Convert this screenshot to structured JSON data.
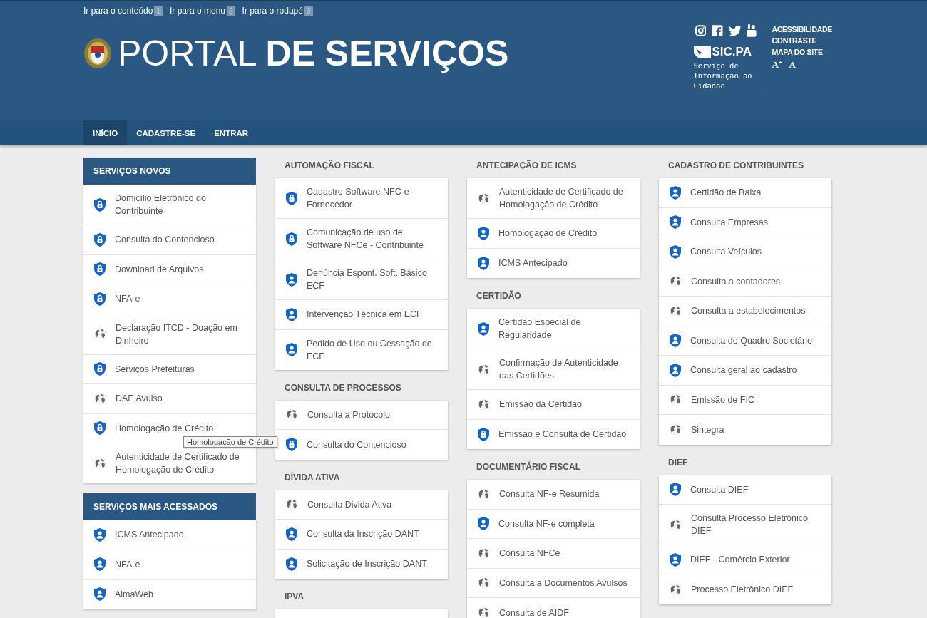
{
  "skip_links": [
    {
      "label": "Ir para o conteúdo",
      "key": "1"
    },
    {
      "label": "Ir para o menu",
      "key": "2"
    },
    {
      "label": "Ir para o rodapé",
      "key": "3"
    }
  ],
  "title": "PORTAL **DE SERVIÇOS**",
  "sic": {
    "logo_text": "SIC.PA",
    "caption": "Serviço de Informação ao Cidadão"
  },
  "accessibility": {
    "links": [
      "ACESSIBILIDADE",
      "CONTRASTE",
      "MAPA DO SITE"
    ],
    "font_up": "A",
    "font_up_mark": "+",
    "font_down": "A",
    "font_down_mark": "-"
  },
  "nav": [
    {
      "label": "INÍCIO",
      "selected": true
    },
    {
      "label": "CADASTRE-SE",
      "selected": false
    },
    {
      "label": "ENTRAR",
      "selected": false
    }
  ],
  "columns": [
    [
      {
        "kind": "panel",
        "title": "SERVIÇOS NOVOS",
        "items": [
          {
            "label": "Domicílio Eletrônico do Contribuinte",
            "kind": "lock"
          },
          {
            "label": "Consulta do Contencioso",
            "kind": "lock"
          },
          {
            "label": "Download de Arquivos",
            "kind": "lock"
          },
          {
            "label": "NFA-e",
            "kind": "lock"
          },
          {
            "label": "Declaração ITCD - Doação em Dinheiro",
            "kind": "globe"
          },
          {
            "label": "Serviços Prefeituras",
            "kind": "lock"
          },
          {
            "label": "DAE Avulso",
            "kind": "globe"
          },
          {
            "label": "Homologação de Crédito",
            "kind": "lock"
          },
          {
            "label": "Autenticidade de Certificado de Homologação de Crédito",
            "kind": "globe"
          }
        ]
      },
      {
        "kind": "panel",
        "title": "SERVIÇOS MAIS ACESSADOS",
        "items": [
          {
            "label": "ICMS Antecipado",
            "kind": "user"
          },
          {
            "label": "NFA-e",
            "kind": "user"
          },
          {
            "label": "AlmaWeb",
            "kind": "user"
          }
        ]
      }
    ],
    [
      {
        "kind": "group",
        "title": "AUTOMAÇÃO FISCAL",
        "items": [
          {
            "label": "Cadastro Software NFC-e - Fornecedor",
            "kind": "lock"
          },
          {
            "label": "Comunicação de uso de Software NFCe - Contribuinte",
            "kind": "lock"
          },
          {
            "label": "Denúncia Espont. Soft. Básico ECF",
            "kind": "user"
          },
          {
            "label": "Intervenção Técnica em ECF",
            "kind": "user"
          },
          {
            "label": "Pedido de Uso ou Cessação de ECF",
            "kind": "user"
          }
        ]
      },
      {
        "kind": "group",
        "title": "CONSULTA DE PROCESSOS",
        "items": [
          {
            "label": "Consulta a Protocolo",
            "kind": "globe"
          },
          {
            "label": "Consulta do Contencioso",
            "kind": "lock"
          }
        ]
      },
      {
        "kind": "group",
        "title": "DÍVIDA ATIVA",
        "items": [
          {
            "label": "Consulta Divida Ativa",
            "kind": "globe"
          },
          {
            "label": "Consulta da Inscrição DANT",
            "kind": "user"
          },
          {
            "label": "Solicitação de Inscrição DANT",
            "kind": "user"
          }
        ]
      },
      {
        "kind": "group",
        "title": "IPVA"
      }
    ],
    [
      {
        "kind": "group",
        "title": "ANTECIPAÇÃO DE ICMS",
        "items": [
          {
            "label": "Autenticidade de Certificado de Homologação de Crédito",
            "kind": "globe"
          },
          {
            "label": "Homologação de Crédito",
            "kind": "user"
          },
          {
            "label": "ICMS Antecipado",
            "kind": "user"
          }
        ]
      },
      {
        "kind": "group",
        "title": "CERTIDÃO",
        "items": [
          {
            "label": "Certidão Especial de Regularidade",
            "kind": "user"
          },
          {
            "label": "Confirmação de Autenticidade das Certidões",
            "kind": "globe"
          },
          {
            "label": "Emissão da Certidão",
            "kind": "globe"
          },
          {
            "label": "Emissão e Consulta de Certidão",
            "kind": "lock"
          }
        ]
      },
      {
        "kind": "group",
        "title": "DOCUMENTÁRIO FISCAL",
        "items": [
          {
            "label": "Consulta NF-e Resumida",
            "kind": "globe"
          },
          {
            "label": "Consulta NF-e completa",
            "kind": "user"
          },
          {
            "label": "Consulta NFCe",
            "kind": "globe"
          },
          {
            "label": "Consulta a Documentos Avulsos",
            "kind": "globe"
          },
          {
            "label": "Consulta de AIDF",
            "kind": "globe"
          }
        ]
      }
    ],
    [
      {
        "kind": "group",
        "title": "CADASTRO DE CONTRIBUINTES",
        "items": [
          {
            "label": "Certidão de Baixa",
            "kind": "user"
          },
          {
            "label": "Consulta Empresas",
            "kind": "user"
          },
          {
            "label": "Consulta Veículos",
            "kind": "user"
          },
          {
            "label": "Consulta a contadores",
            "kind": "globe"
          },
          {
            "label": "Consulta a estabelecimentos",
            "kind": "globe"
          },
          {
            "label": "Consulta do Quadro Societário",
            "kind": "user"
          },
          {
            "label": "Consulta geral ao cadastro",
            "kind": "user"
          },
          {
            "label": "Emissão de FIC",
            "kind": "globe"
          },
          {
            "label": "Sintegra",
            "kind": "globe"
          }
        ]
      },
      {
        "kind": "group",
        "title": "DIEF",
        "items": [
          {
            "label": "Consulta DIEF",
            "kind": "user"
          },
          {
            "label": "Consulta Processo Eletrônico DIEF",
            "kind": "globe"
          },
          {
            "label": "DIEF - Comércio Exterior",
            "kind": "user"
          },
          {
            "label": "Processo Eletrônico DIEF",
            "kind": "globe"
          }
        ]
      }
    ]
  ],
  "tooltip": {
    "text": "Homologação de Crédito"
  }
}
